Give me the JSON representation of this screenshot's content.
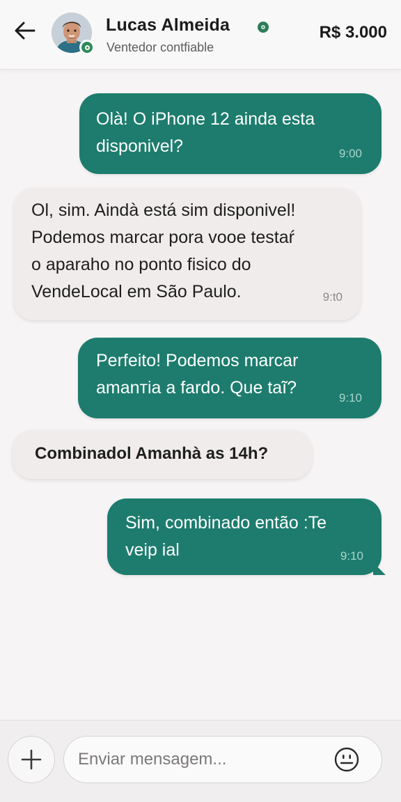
{
  "header": {
    "back_icon": "arrow-left-icon",
    "seller_name": "Lucas Almeida",
    "seller_status": "Ventedor contfiable",
    "price": "R$ 3.000",
    "verified_color": "#2e7d5a"
  },
  "messages": [
    {
      "side": "sent",
      "text": "Olà! O iPhone 12 ainda esta\ndisponivel?",
      "time": "9:00"
    },
    {
      "side": "received",
      "text": "Ol, sim. Aindà está sim disponivel!\nPodemos marcar pora vooe testaŕ\no aparaho no ponto fisico do\nVendeLocal em São Paulo.",
      "time": "9:t0"
    },
    {
      "side": "sent",
      "text": "Perfeito! Podemos marcar\namanтia a fardo. Que taĩ?",
      "time": "9:10"
    },
    {
      "side": "received",
      "text": "Combinadol Amanhà as 14h?",
      "time": ""
    },
    {
      "side": "sent",
      "text": "Sim, combinado então :Te\nveip ial",
      "time": "9:10"
    }
  ],
  "composer": {
    "add_icon": "plus-icon",
    "placeholder": "Enviar mensagem...",
    "emoji_icon": "emoji-icon"
  },
  "colors": {
    "sent_bubble": "#1d7c6d",
    "received_bubble": "#f1ecec",
    "background": "#f6f4f5"
  }
}
